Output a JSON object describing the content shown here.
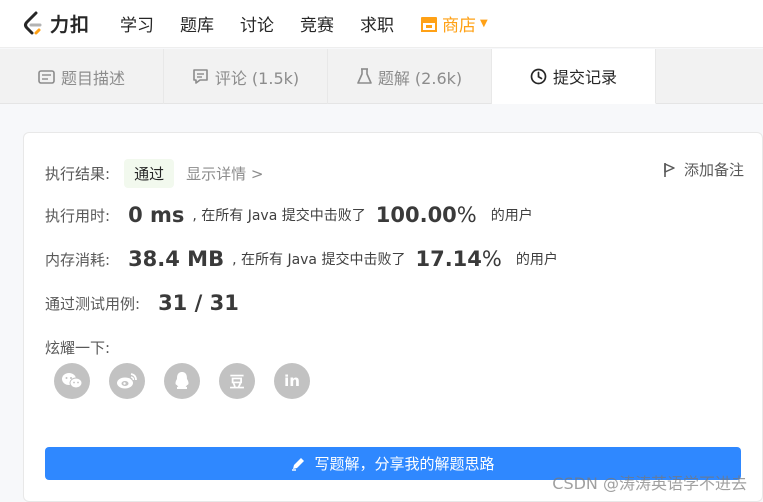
{
  "nav": {
    "logo_text": "力扣",
    "items": [
      "学习",
      "题库",
      "讨论",
      "竞赛",
      "求职"
    ],
    "shop_label": "商店",
    "colors": {
      "shop": "#ffa116"
    }
  },
  "tabs": [
    {
      "label": "题目描述",
      "icon": "description-icon"
    },
    {
      "label": "评论 (1.5k)",
      "icon": "comment-icon"
    },
    {
      "label": "题解 (2.6k)",
      "icon": "flask-icon"
    },
    {
      "label": "提交记录",
      "icon": "clock-icon",
      "active": true
    }
  ],
  "result": {
    "label": "执行结果:",
    "status": "通过",
    "detail_link": "显示详情 >",
    "note_label": "添加备注"
  },
  "runtime": {
    "label": "执行用时:",
    "value": "0 ms",
    "middle": ", 在所有 Java 提交中击败了",
    "percent": "100.00",
    "percent_sign": "%",
    "tail": "的用户"
  },
  "memory": {
    "label": "内存消耗:",
    "value": "38.4 MB",
    "middle": ", 在所有 Java 提交中击败了",
    "percent": "17.14",
    "percent_sign": "%",
    "tail": "的用户"
  },
  "tests": {
    "label": "通过测试用例:",
    "value": "31 / 31"
  },
  "share": {
    "label": "炫耀一下:",
    "buttons": [
      "wechat-icon",
      "weibo-icon",
      "qq-icon",
      "douban-icon",
      "linkedin-icon"
    ],
    "douban_glyph": "豆",
    "linkedin_glyph": "in"
  },
  "write_button": {
    "label": "写题解，分享我的解题思路",
    "color": "#2f88ff"
  },
  "watermark": "CSDN @涛涛英语学不进去"
}
